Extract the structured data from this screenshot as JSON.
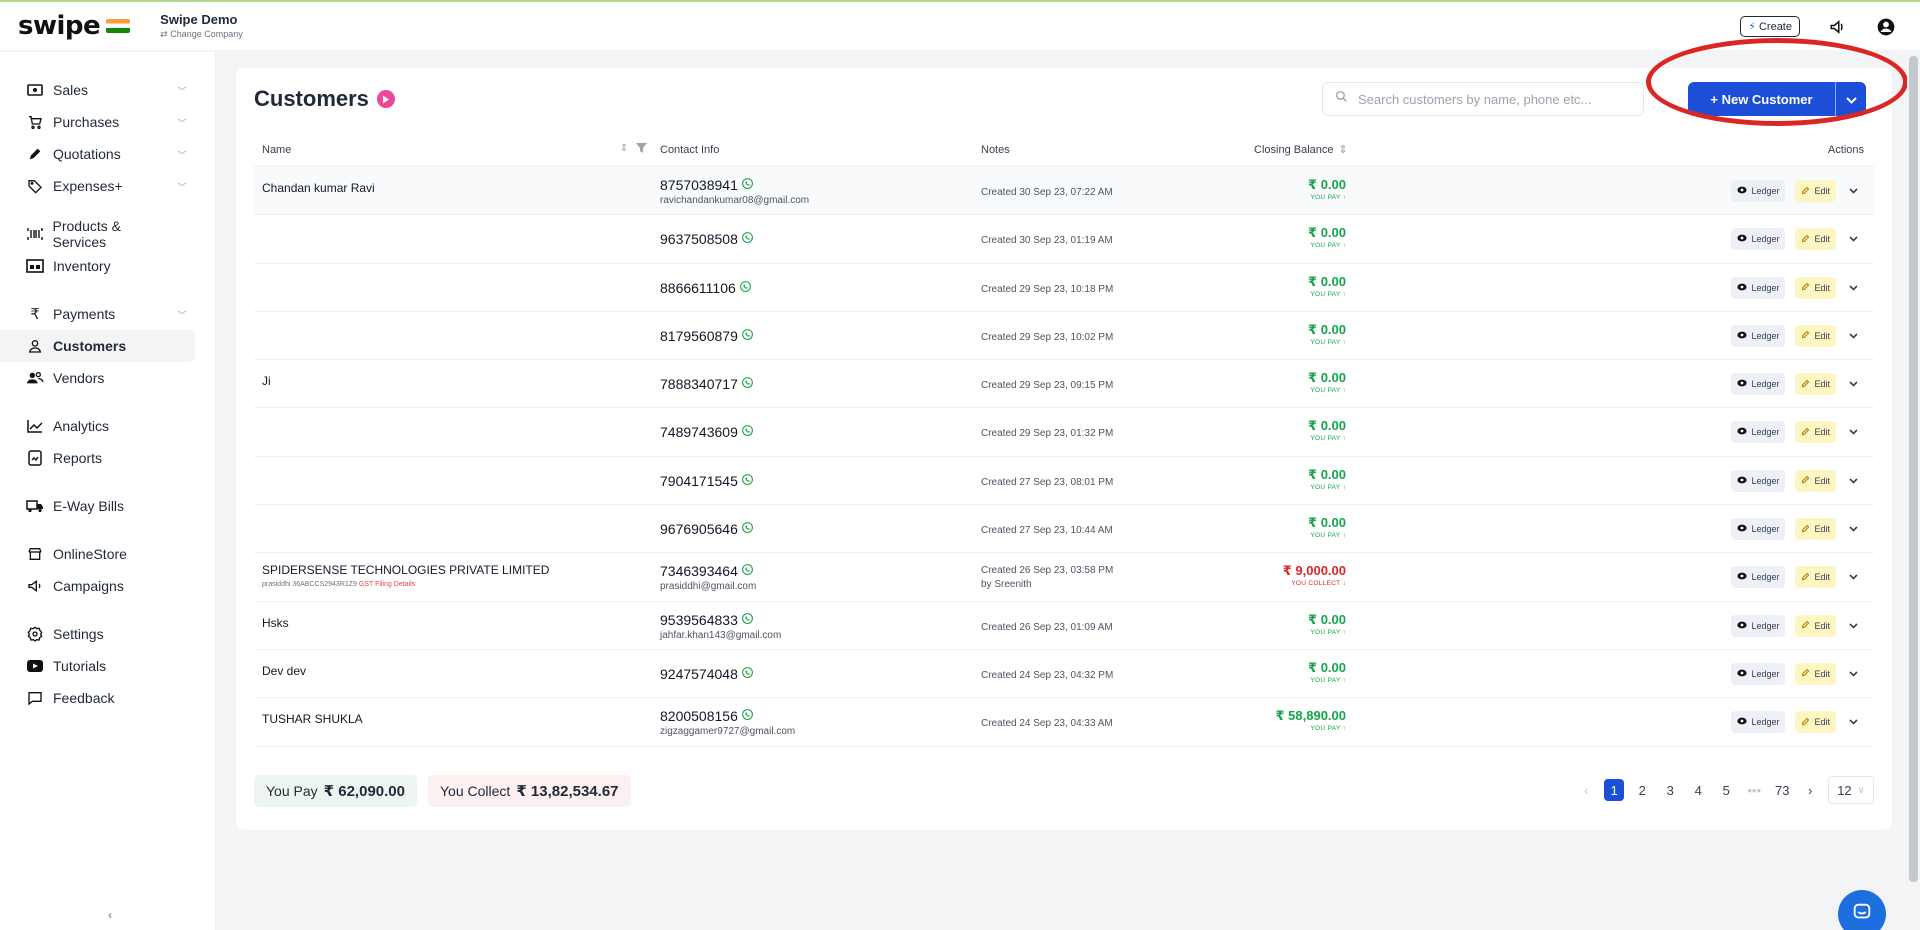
{
  "topbar": {
    "logo_text": "swipe",
    "company_name": "Swipe Demo",
    "change_company": "⇄ Change Company",
    "create_label": "Create"
  },
  "sidebar": {
    "items": [
      {
        "label": "Sales",
        "icon": "cash-icon",
        "chevron": true
      },
      {
        "label": "Purchases",
        "icon": "cart-icon",
        "chevron": true
      },
      {
        "label": "Quotations",
        "icon": "pen-icon",
        "chevron": true
      },
      {
        "label": "Expenses+",
        "icon": "tag-icon",
        "chevron": true
      },
      {
        "label": "Products & Services",
        "icon": "barcode-icon",
        "chevron": false
      },
      {
        "label": "Inventory",
        "icon": "warehouse-icon",
        "chevron": false
      },
      {
        "label": "Payments",
        "icon": "rupee-icon",
        "chevron": true
      },
      {
        "label": "Customers",
        "icon": "user-icon",
        "chevron": false
      },
      {
        "label": "Vendors",
        "icon": "users-icon",
        "chevron": false
      },
      {
        "label": "Analytics",
        "icon": "chart-icon",
        "chevron": false
      },
      {
        "label": "Reports",
        "icon": "report-icon",
        "chevron": false
      },
      {
        "label": "E-Way Bills",
        "icon": "truck-icon",
        "chevron": false
      },
      {
        "label": "OnlineStore",
        "icon": "store-icon",
        "chevron": false
      },
      {
        "label": "Campaigns",
        "icon": "megaphone-icon",
        "chevron": false
      },
      {
        "label": "Settings",
        "icon": "gear-icon",
        "chevron": false
      },
      {
        "label": "Tutorials",
        "icon": "youtube-icon",
        "chevron": false
      },
      {
        "label": "Feedback",
        "icon": "chat-icon",
        "chevron": false
      }
    ],
    "bottom_glyph": "‹"
  },
  "main": {
    "title": "Customers",
    "search_placeholder": "Search customers by name, phone etc...",
    "new_customer_label": "+ New Customer",
    "columns": {
      "name": "Name",
      "contact": "Contact Info",
      "notes": "Notes",
      "balance": "Closing Balance",
      "actions": "Actions"
    },
    "rows": [
      {
        "name": "Chandan kumar Ravi",
        "sub": "",
        "gst": "",
        "phone": "8757038941",
        "email": "ravichandankumar08@gmail.com",
        "note": "Created 30 Sep 23, 07:22 AM",
        "note2": "",
        "amount": "₹ 0.00",
        "label": "YOU PAY ↑",
        "collect": false
      },
      {
        "name": "",
        "sub": "",
        "gst": "",
        "phone": "9637508508",
        "email": "",
        "note": "Created 30 Sep 23, 01:19 AM",
        "note2": "",
        "amount": "₹ 0.00",
        "label": "YOU PAY ↑",
        "collect": false
      },
      {
        "name": "",
        "sub": "",
        "gst": "",
        "phone": "8866611106",
        "email": "",
        "note": "Created 29 Sep 23, 10:18 PM",
        "note2": "",
        "amount": "₹ 0.00",
        "label": "YOU PAY ↑",
        "collect": false
      },
      {
        "name": "",
        "sub": "",
        "gst": "",
        "phone": "8179560879",
        "email": "",
        "note": "Created 29 Sep 23, 10:02 PM",
        "note2": "",
        "amount": "₹ 0.00",
        "label": "YOU PAY ↑",
        "collect": false
      },
      {
        "name": "Ji",
        "sub": "",
        "gst": "",
        "phone": "7888340717",
        "email": "",
        "note": "Created 29 Sep 23, 09:15 PM",
        "note2": "",
        "amount": "₹ 0.00",
        "label": "YOU PAY ↑",
        "collect": false
      },
      {
        "name": "",
        "sub": "",
        "gst": "",
        "phone": "7489743609",
        "email": "",
        "note": "Created 29 Sep 23, 01:32 PM",
        "note2": "",
        "amount": "₹ 0.00",
        "label": "YOU PAY ↑",
        "collect": false
      },
      {
        "name": "",
        "sub": "",
        "gst": "",
        "phone": "7904171545",
        "email": "",
        "note": "Created 27 Sep 23, 08:01 PM",
        "note2": "",
        "amount": "₹ 0.00",
        "label": "YOU PAY ↑",
        "collect": false
      },
      {
        "name": "",
        "sub": "",
        "gst": "",
        "phone": "9676905646",
        "email": "",
        "note": "Created 27 Sep 23, 10:44 AM",
        "note2": "",
        "amount": "₹ 0.00",
        "label": "YOU PAY ↑",
        "collect": false
      },
      {
        "name": "SPIDERSENSE TECHNOLOGIES PRIVATE LIMITED",
        "sub": "prasiddhi  36ABCCS2943R1Z9 ",
        "gst": "GST Filing Details",
        "phone": "7346393464",
        "email": "prasiddhi@gmail.com",
        "note": "Created 26 Sep 23, 03:58 PM",
        "note2": "by Sreenith",
        "amount": "₹ 9,000.00",
        "label": "YOU COLLECT ↓",
        "collect": true
      },
      {
        "name": "Hsks",
        "sub": "",
        "gst": "",
        "phone": "9539564833",
        "email": "jahfar.khan143@gmail.com",
        "note": "Created 26 Sep 23, 01:09 AM",
        "note2": "",
        "amount": "₹ 0.00",
        "label": "YOU PAY ↑",
        "collect": false
      },
      {
        "name": "Dev dev",
        "sub": "",
        "gst": "",
        "phone": "9247574048",
        "email": "",
        "note": "Created 24 Sep 23, 04:32 PM",
        "note2": "",
        "amount": "₹ 0.00",
        "label": "YOU PAY ↑",
        "collect": false
      },
      {
        "name": "TUSHAR SHUKLA",
        "sub": "",
        "gst": "",
        "phone": "8200508156",
        "email": "zigzaggamer9727@gmail.com",
        "note": "Created 24 Sep 23, 04:33 AM",
        "note2": "",
        "amount": "₹ 58,890.00",
        "label": "YOU PAY ↑",
        "collect": false
      }
    ],
    "ledger_label": "Ledger",
    "edit_label": "Edit",
    "you_pay_label": "You Pay",
    "you_pay_amount": "₹ 62,090.00",
    "you_collect_label": "You Collect",
    "you_collect_amount": "₹ 13,82,534.67",
    "pages": [
      "1",
      "2",
      "3",
      "4",
      "5",
      "•••",
      "73"
    ],
    "page_size": "12"
  },
  "colors": {
    "primary": "#1d4ed8",
    "accent_pink": "#ec4899",
    "pay_green": "#16a34a",
    "collect_red": "#dc2626",
    "highlight_ring": "#dc2626"
  }
}
